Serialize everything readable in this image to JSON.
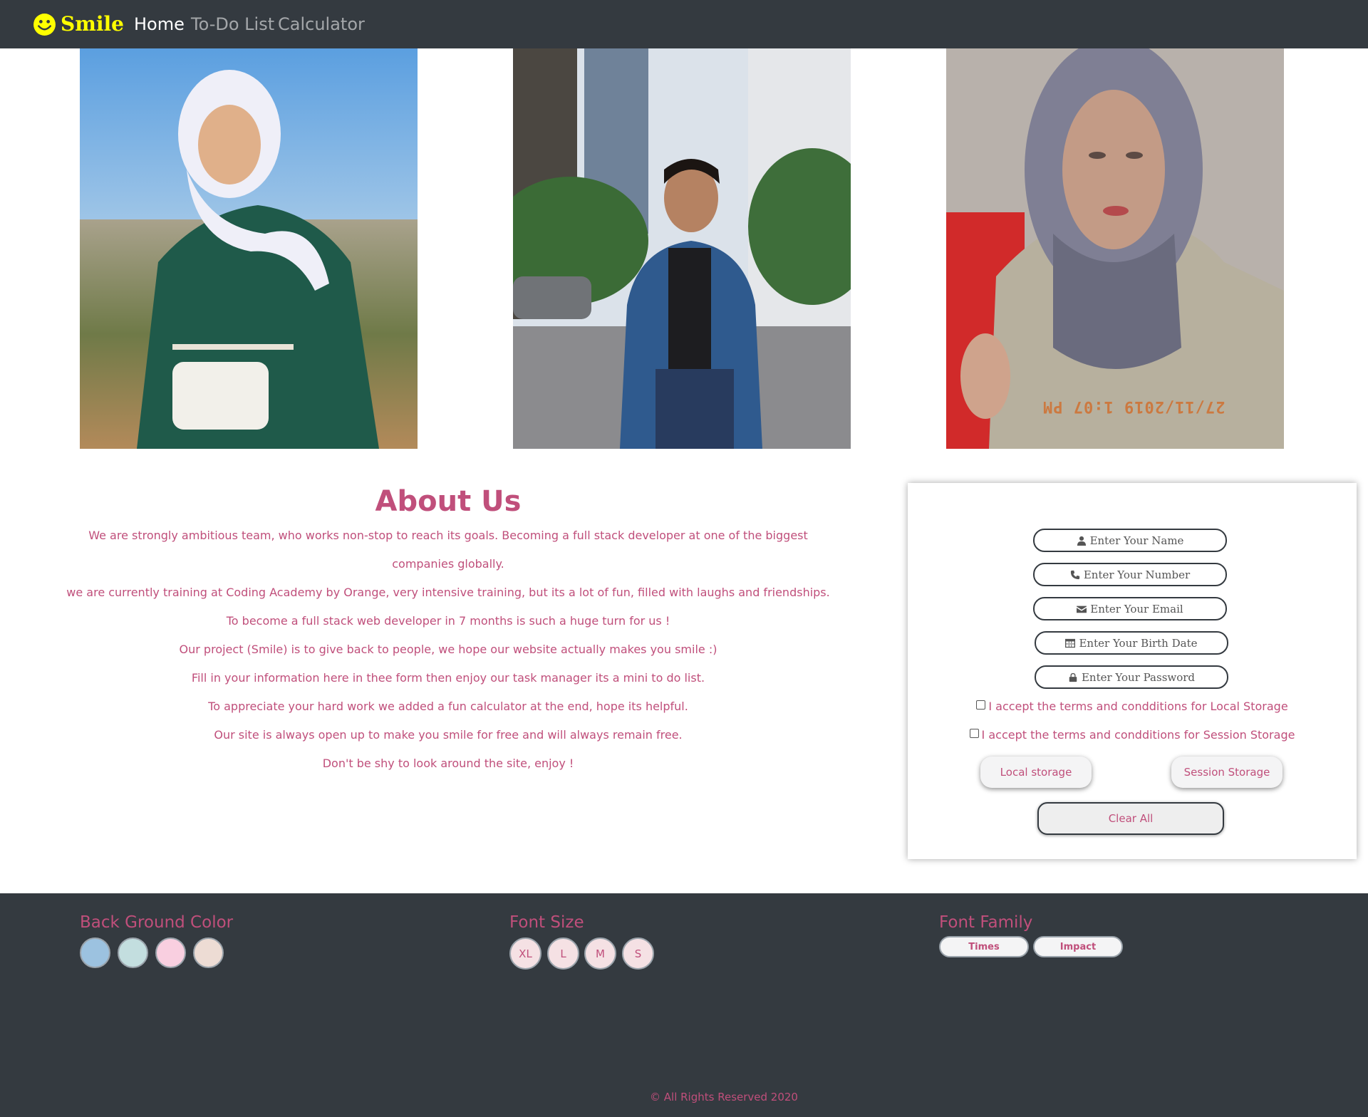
{
  "navbar": {
    "brand": "Smile",
    "links": [
      "Home",
      "To-Do List",
      "Calculator"
    ],
    "active": "Home",
    "brand_color": "#ffff00",
    "bg_color": "#343a40"
  },
  "photos": [
    {
      "name": "photo-woman-white-hijab"
    },
    {
      "name": "photo-man-denim-jacket"
    },
    {
      "name": "photo-woman-grey-hijab",
      "timestamp": "27/11/2019 1:07 PM"
    }
  ],
  "about": {
    "title": "About Us",
    "paragraphs": [
      "We are strongly ambitious team, who works non-stop to reach its goals. Becoming a full stack developer at one of the biggest companies globally.",
      "we are currently training at Coding Academy by Orange, very intensive training, but its a lot of fun, filled with laughs and friendships.",
      "To become a full stack web developer in 7 months is such a huge turn for us !",
      "Our project (Smile) is to give back to people, we hope our website actually makes you smile :)",
      "Fill in your information here in thee form then enjoy our task manager its a mini to do list.",
      "To appreciate your hard work we added a fun calculator at the end, hope its helpful.",
      "Our site is always open up to make you smile for free and will always remain free.",
      "Don't be shy to look around the site, enjoy !"
    ],
    "text_color": "#c04f7b"
  },
  "form": {
    "name_placeholder": "Enter Your Name",
    "number_placeholder": "Enter Your Number",
    "email_placeholder": "Enter Your Email",
    "birth_placeholder": "Enter Your Birth Date",
    "password_placeholder": "Enter Your Password",
    "local_terms": "I accept the terms and condditions for Local Storage",
    "session_terms": "I accept the terms and condditions for Session Storage",
    "local_button": "Local storage",
    "session_button": "Session Storage",
    "clear_button": "Clear All"
  },
  "footer": {
    "bg_title": "Back Ground Color",
    "bg_swatches": [
      "#9cc2e0",
      "#c3dedf",
      "#f9cfe0",
      "#eddcd4"
    ],
    "size_title": "Font Size",
    "sizes": [
      "XL",
      "L",
      "M",
      "S"
    ],
    "family_title": "Font Family",
    "families": [
      "Times",
      "Impact"
    ],
    "copyright": "© All Rights Reserved 2020"
  }
}
